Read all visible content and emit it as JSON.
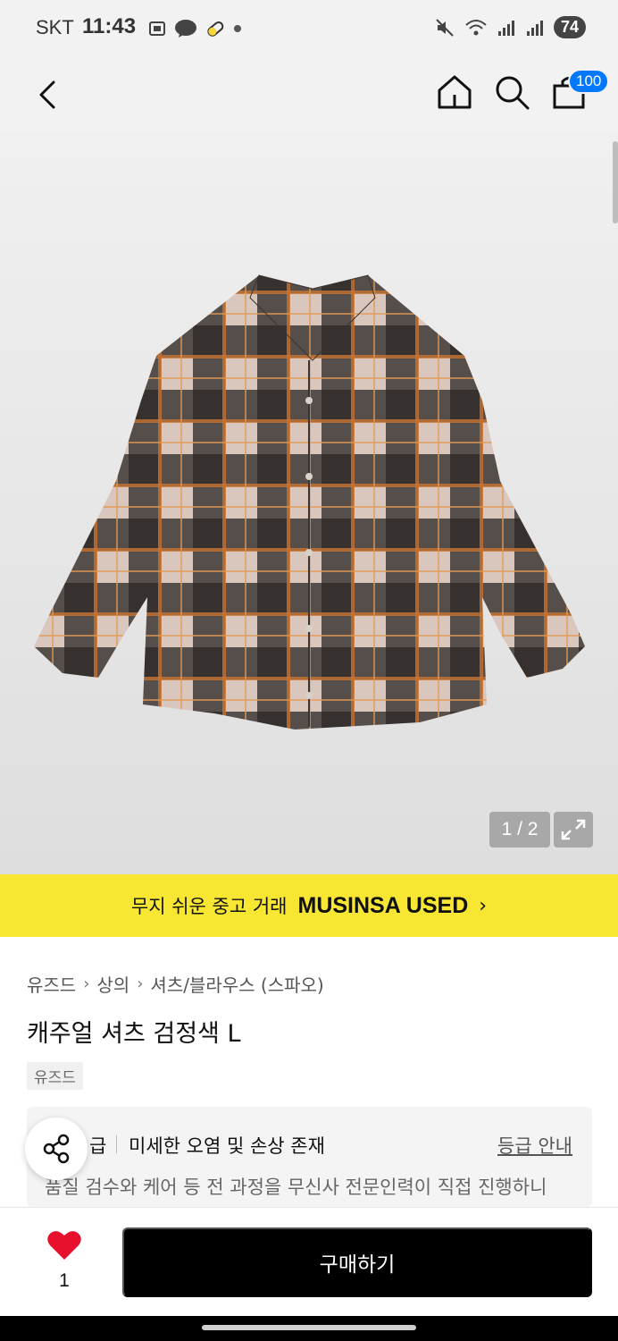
{
  "status_bar": {
    "carrier": "SKT",
    "time": "11:43",
    "battery": "74",
    "left_icons": [
      "screenshot-icon",
      "kakaotalk-icon",
      "pill-icon",
      "dot-icon"
    ],
    "right_icons": [
      "mute-icon",
      "wifi-icon",
      "signal-icon",
      "signal-roaming-icon",
      "battery-icon"
    ]
  },
  "top_nav": {
    "back_icon": "chevron-left-icon",
    "home_icon": "home-icon",
    "search_icon": "search-icon",
    "cart_icon": "shopping-bag-icon",
    "cart_count": "100"
  },
  "product_image": {
    "counter": "1 / 2",
    "expand_icon": "expand-icon",
    "description": "plaid-shirt"
  },
  "banner": {
    "text": "무지 쉬운 중고 거래",
    "brand": "MUSINSA USED",
    "chevron": "›"
  },
  "breadcrumb": [
    "유즈드",
    "상의",
    "셔츠/블라우스 (스파오)"
  ],
  "product": {
    "title": "캐주얼 셔츠 검정색 L",
    "tag": "유즈드"
  },
  "grade": {
    "suffix": "급",
    "description": "미세한 오염 및 손상 존재",
    "link": "등급 안내",
    "sub_text": "품질 검수와 케어 등 전 과정을 무신사 전문인력이 직접 진행하니"
  },
  "bottom_bar": {
    "like_count": "1",
    "buy_label": "구매하기"
  },
  "colors": {
    "accent_yellow": "#f7e733",
    "badge_blue": "#0078ff",
    "heart_red": "#e8112d",
    "buy_black": "#000000"
  }
}
